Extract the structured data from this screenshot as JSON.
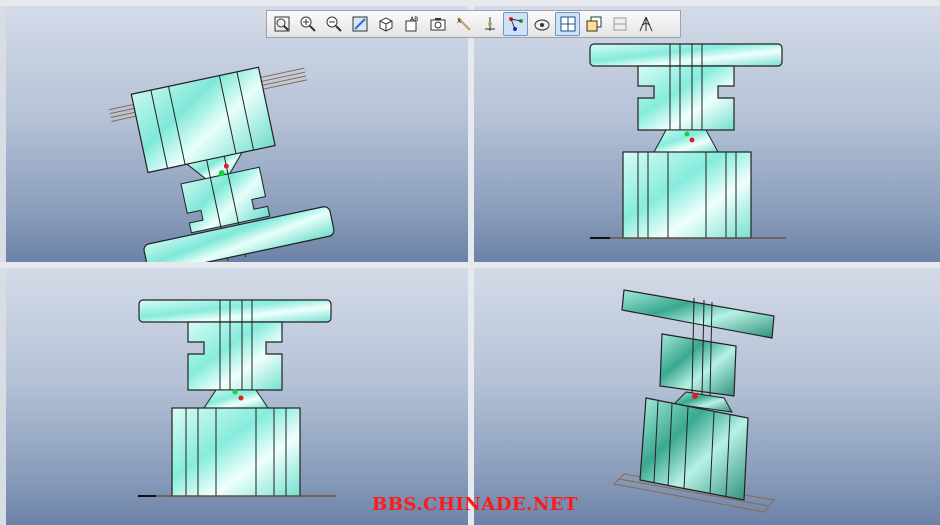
{
  "app": {
    "layout": "four-viewport",
    "accent_color": "#7fe8d8"
  },
  "toolbar": {
    "buttons": [
      {
        "name": "zoom-fit-icon",
        "active": false
      },
      {
        "name": "zoom-in-icon",
        "active": false
      },
      {
        "name": "zoom-out-icon",
        "active": false
      },
      {
        "name": "repaint-icon",
        "active": false
      },
      {
        "name": "display-style-icon",
        "active": false
      },
      {
        "name": "named-views-icon",
        "active": false
      },
      {
        "name": "camera-icon",
        "active": false
      },
      {
        "name": "datum-axis-icon",
        "active": false
      },
      {
        "name": "datum-point-icon",
        "active": false
      },
      {
        "name": "spin-center-icon",
        "active": true
      },
      {
        "name": "annotation-display-icon",
        "active": false
      },
      {
        "name": "multi-view-icon",
        "active": true
      },
      {
        "name": "view-manager-icon",
        "active": false
      },
      {
        "name": "section-icon",
        "active": false
      },
      {
        "name": "perspective-icon",
        "active": false
      }
    ]
  },
  "watermark": {
    "text": "BBS.CHINADE.NET",
    "color": "#ff1a1a"
  }
}
